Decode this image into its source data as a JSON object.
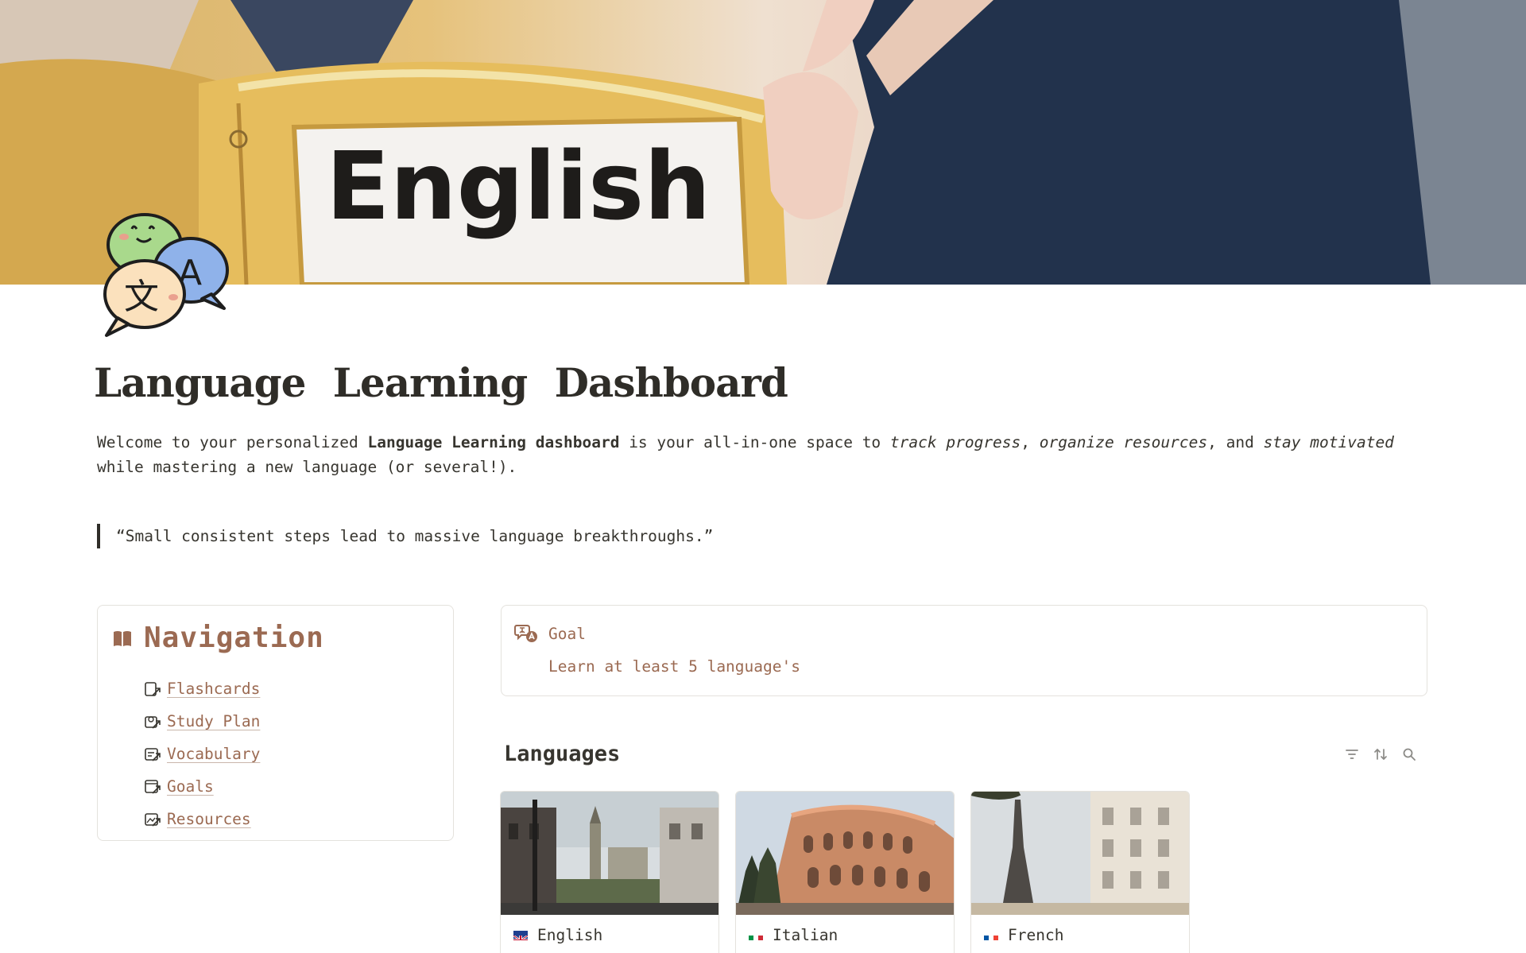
{
  "page": {
    "title": "Language Learning Dashboard",
    "cover_text": "English"
  },
  "intro": {
    "part1": "Welcome to your personalized ",
    "bold": "Language Learning dashboard",
    "part2": " is your all-in-one space to ",
    "italic1": "track progress",
    "sep1": ", ",
    "italic2": "organize resources",
    "sep2": ", and ",
    "italic3": "stay motivated",
    "part3": " while mastering a new language (or several!)."
  },
  "quote": "“Small consistent steps lead to massive language breakthroughs.”",
  "navigation": {
    "title": "Navigation",
    "items": [
      {
        "label": "Flashcards"
      },
      {
        "label": "Study Plan"
      },
      {
        "label": "Vocabulary"
      },
      {
        "label": "Goals"
      },
      {
        "label": "Resources"
      }
    ]
  },
  "goal": {
    "label": "Goal",
    "text": "Learn at least 5 language's"
  },
  "languages": {
    "heading": "Languages",
    "cards": [
      {
        "name": "English",
        "flag": "uk-flag"
      },
      {
        "name": "Italian",
        "flag": "italy-flag"
      },
      {
        "name": "French",
        "flag": "france-flag"
      }
    ]
  },
  "colors": {
    "accent_brown": "#9b6a52",
    "text": "#37352f",
    "border": "#e4e2dd"
  }
}
